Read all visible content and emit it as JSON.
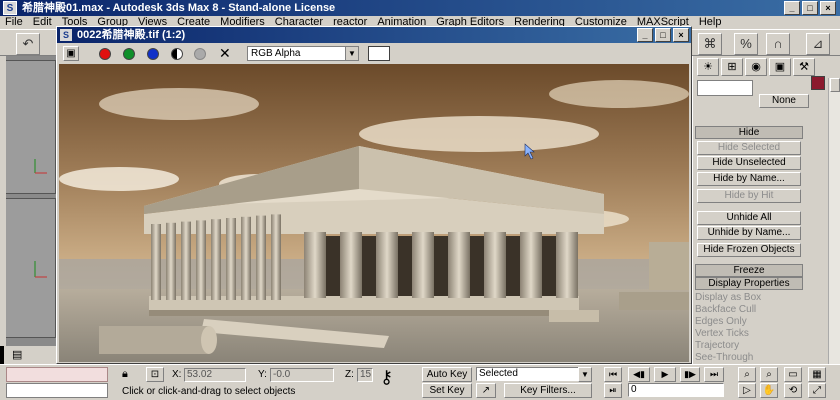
{
  "app": {
    "title": "希腊神殿01.max - Autodesk 3ds Max 8 - Stand-alone License",
    "icon": "3ds-max-icon"
  },
  "menu": [
    "File",
    "Edit",
    "Tools",
    "Group",
    "Views",
    "Create",
    "Modifiers",
    "Character",
    "reactor",
    "Animation",
    "Graph Editors",
    "Rendering",
    "Customize",
    "MAXScript",
    "Help"
  ],
  "image_window": {
    "title": "0022希腊神殿.tif (1:2)",
    "channel": "RGB Alpha"
  },
  "command_panel": {
    "none_label": "None",
    "color_swatch": "#8b1a2e",
    "hide_rollout": "Hide",
    "buttons": [
      {
        "label": "Hide Selected",
        "enabled": false
      },
      {
        "label": "Hide Unselected",
        "enabled": true
      },
      {
        "label": "Hide by Name...",
        "enabled": true
      },
      {
        "label": "Hide by Hit",
        "enabled": false
      },
      {
        "label": "Unhide All",
        "enabled": true
      },
      {
        "label": "Unhide by Name...",
        "enabled": true
      },
      {
        "label": "Hide Frozen Objects",
        "enabled": true
      }
    ],
    "freeze_rollout": "Freeze",
    "display_rollout": "Display Properties",
    "display_items": [
      "Display as Box",
      "Backface Cull",
      "Edges Only",
      "Vertex Ticks",
      "Trajectory",
      "See-Through"
    ]
  },
  "status": {
    "x_label": "X:",
    "x_value": "53.02",
    "y_label": "Y:",
    "y_value": "-0.0",
    "z_label": "Z:",
    "z_value": "15",
    "prompt": "Click or click-and-drag to select objects",
    "auto_key": "Auto Key",
    "set_key": "Set Key",
    "selected": "Selected",
    "key_filters": "Key Filters...",
    "frame": "0"
  }
}
